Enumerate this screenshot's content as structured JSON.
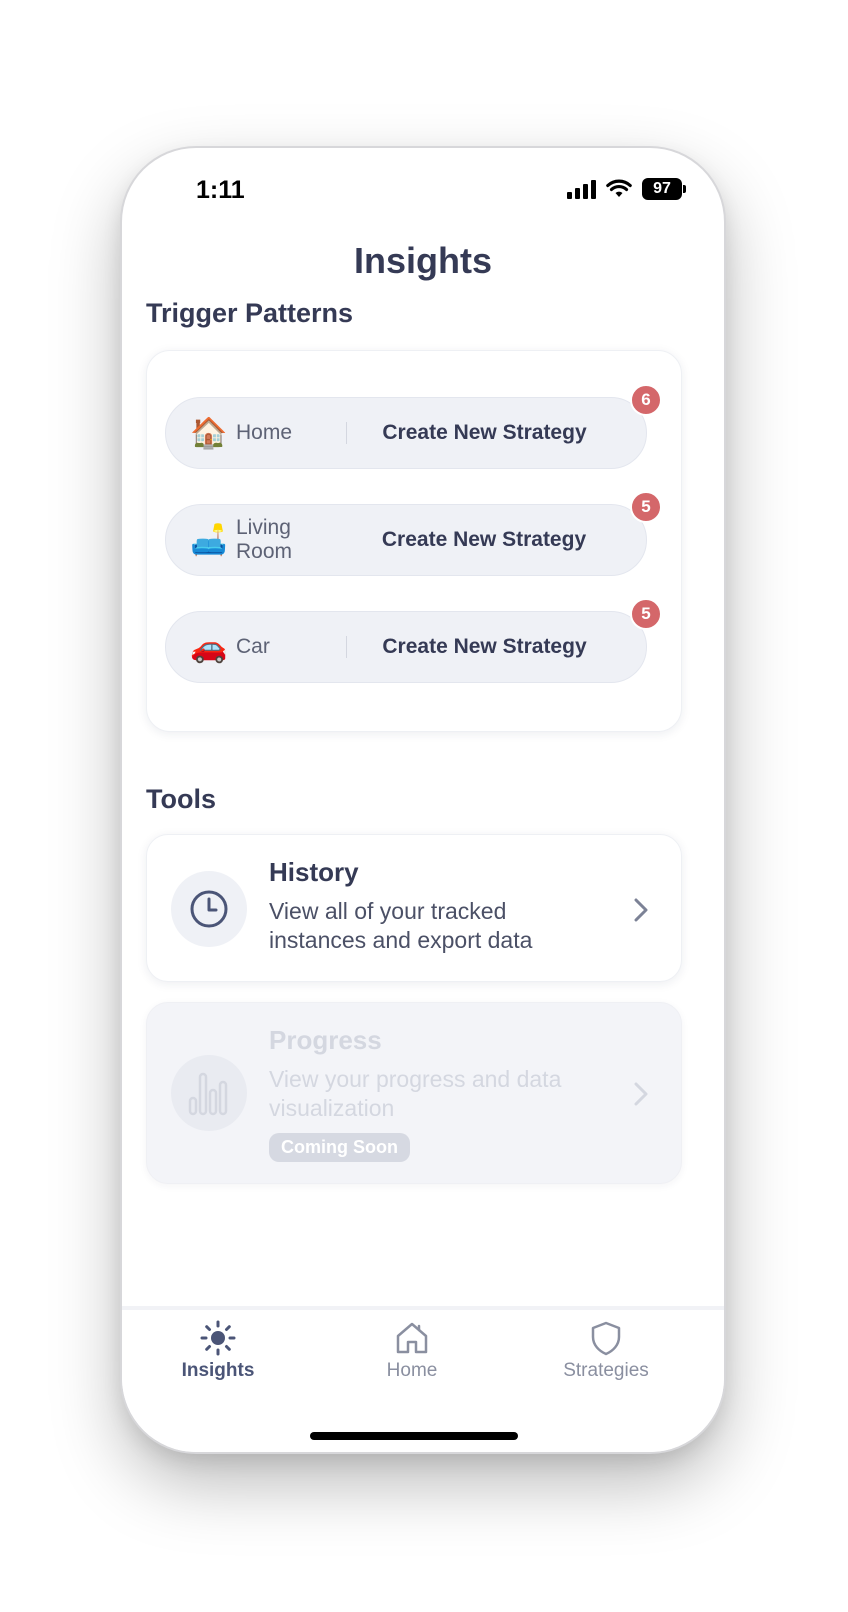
{
  "status_bar": {
    "time": "1:11",
    "battery": "97"
  },
  "page_title": "Insights",
  "trigger_section": {
    "title": "Trigger Patterns",
    "items": [
      {
        "emoji": "🏠",
        "label": "Home",
        "action": "Create New Strategy",
        "count": "6"
      },
      {
        "emoji": "🛋️",
        "label": "Living Room",
        "action": "Create New Strategy",
        "count": "5"
      },
      {
        "emoji": "🚗",
        "label": "Car",
        "action": "Create New Strategy",
        "count": "5"
      }
    ]
  },
  "tools_section": {
    "title": "Tools",
    "history": {
      "title": "History",
      "description": "View all of your tracked instances and export data",
      "icon": "clock-icon"
    },
    "progress": {
      "title": "Progress",
      "description": "View your progress and data visualization",
      "badge": "Coming Soon",
      "icon": "bar-chart-icon"
    }
  },
  "tabbar": {
    "tabs": [
      {
        "label": "Insights",
        "icon": "sun-icon",
        "active": true
      },
      {
        "label": "Home",
        "icon": "house-icon",
        "active": false
      },
      {
        "label": "Strategies",
        "icon": "shield-icon",
        "active": false
      }
    ]
  },
  "colors": {
    "text_primary": "#353a55",
    "badge": "#d4676a",
    "pill_bg": "#eff1f6",
    "tab_active": "#4b5577"
  }
}
